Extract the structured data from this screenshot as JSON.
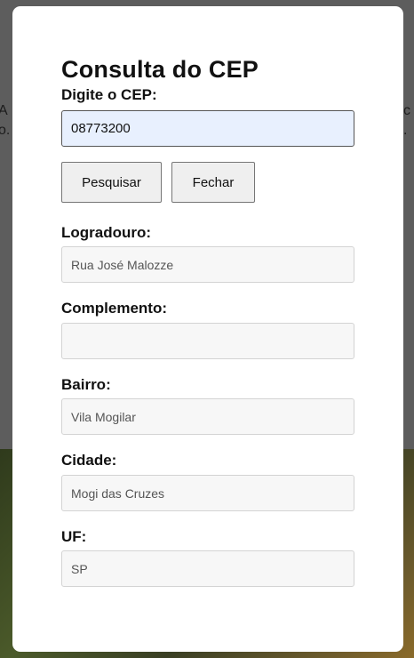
{
  "background": {
    "left_fragment": "A\no.",
    "right_fragment": "c\n."
  },
  "modal": {
    "title": "Consulta do CEP",
    "cep_label": "Digite o CEP:",
    "cep_value": "08773200",
    "buttons": {
      "search": "Pesquisar",
      "close": "Fechar"
    },
    "fields": {
      "logradouro": {
        "label": "Logradouro:",
        "value": "Rua José Malozze"
      },
      "complemento": {
        "label": "Complemento:",
        "value": ""
      },
      "bairro": {
        "label": "Bairro:",
        "value": "Vila Mogilar"
      },
      "cidade": {
        "label": "Cidade:",
        "value": "Mogi das Cruzes"
      },
      "uf": {
        "label": "UF:",
        "value": "SP"
      }
    }
  }
}
